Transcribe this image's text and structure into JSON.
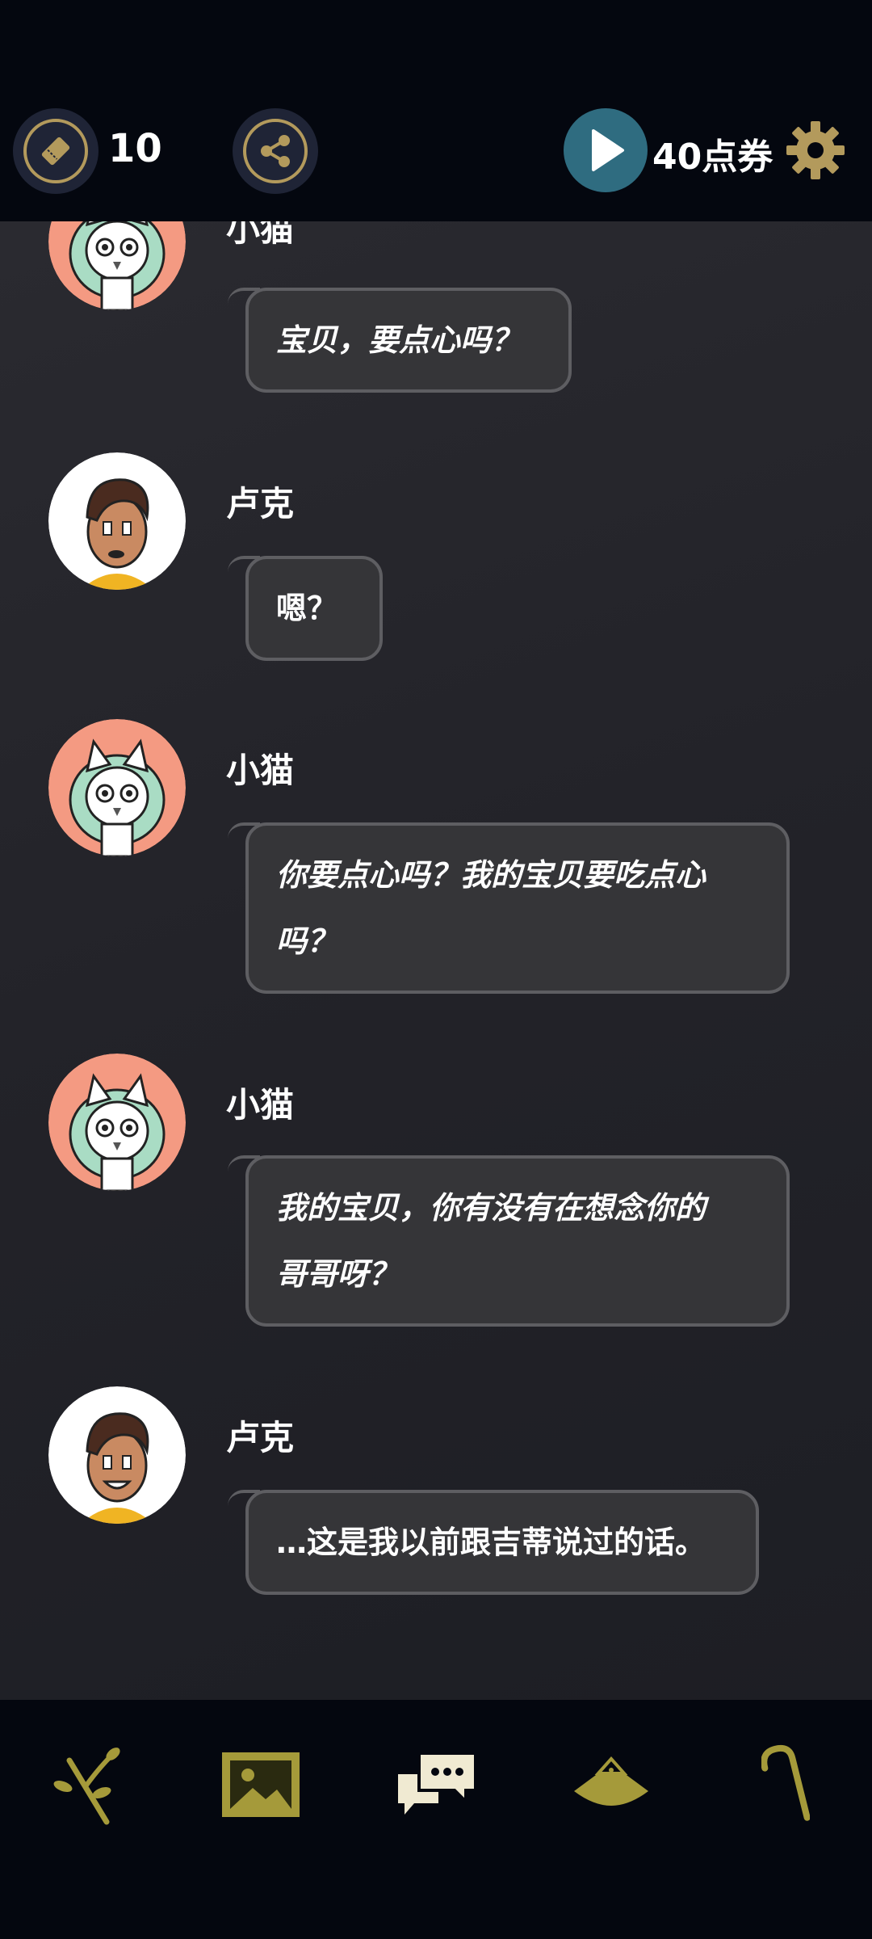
{
  "topbar": {
    "ticket_count": "10",
    "points_label": "40点券"
  },
  "messages": [
    {
      "speaker": "小猫",
      "text": "宝贝，要点心吗？"
    },
    {
      "speaker": "卢克",
      "text": "嗯？"
    },
    {
      "speaker": "小猫",
      "text": "你要点心吗？我的宝贝要吃点心吗？",
      "line1": "你要点心吗？我的宝贝要吃点心",
      "line2": "吗？"
    },
    {
      "speaker": "小猫",
      "text": "我的宝贝，你有没有在想念你的哥哥呀？",
      "line1": "我的宝贝，你有没有在想念你的",
      "line2": "哥哥呀？"
    },
    {
      "speaker": "卢克",
      "text": "…这是我以前跟吉蒂说过的话。"
    }
  ],
  "icons": {
    "ticket": "ticket-icon",
    "share": "share-icon",
    "play": "play-icon",
    "settings": "gear-icon",
    "nav": [
      "branch-icon",
      "gallery-icon",
      "chat-icon",
      "hat-icon",
      "cane-icon"
    ]
  },
  "colors": {
    "accent_gold": "#b39a5c",
    "nav_olive": "#a59a3a",
    "play_teal": "#2f6c80",
    "bubble_bg": "#353538",
    "cat_avatar_bg": "#f49a82"
  }
}
